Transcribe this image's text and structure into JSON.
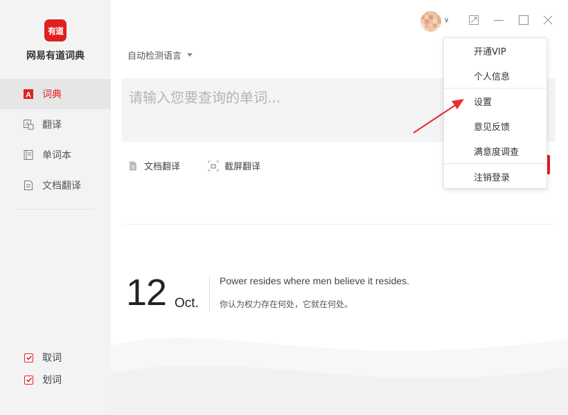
{
  "app": {
    "logo_text": "有道",
    "name": "网易有道词典"
  },
  "sidebar": {
    "items": [
      {
        "label": "词典",
        "icon": "dict-icon",
        "active": true
      },
      {
        "label": "翻译",
        "icon": "translate-icon",
        "active": false
      },
      {
        "label": "单词本",
        "icon": "wordbook-icon",
        "active": false
      },
      {
        "label": "文档翻译",
        "icon": "doc-translate-icon",
        "active": false
      }
    ],
    "checkboxes": [
      {
        "label": "取词",
        "checked": true
      },
      {
        "label": "划词",
        "checked": true
      }
    ]
  },
  "main": {
    "language_selector": "自动检测语言",
    "search_placeholder": "请输入您要查询的单词...",
    "tools": [
      {
        "label": "文档翻译",
        "icon": "document-icon"
      },
      {
        "label": "截屏翻译",
        "icon": "screenshot-icon"
      }
    ],
    "daily": {
      "day": "12",
      "month": "Oct.",
      "quote_en": "Power resides where men believe it resides.",
      "quote_zh": "你认为权力存在何处，它就在何处。"
    }
  },
  "titlebar": {
    "buttons": [
      "mini-mode-icon",
      "minimize-icon",
      "maximize-icon",
      "close-icon"
    ]
  },
  "user_menu": {
    "items": [
      "开通VIP",
      "个人信息",
      "设置",
      "意见反馈",
      "满意度调查",
      "注销登录"
    ]
  },
  "colors": {
    "accent": "#e02020",
    "sidebar_bg": "#f3f3f3",
    "active_bg": "#e6e6e6"
  }
}
